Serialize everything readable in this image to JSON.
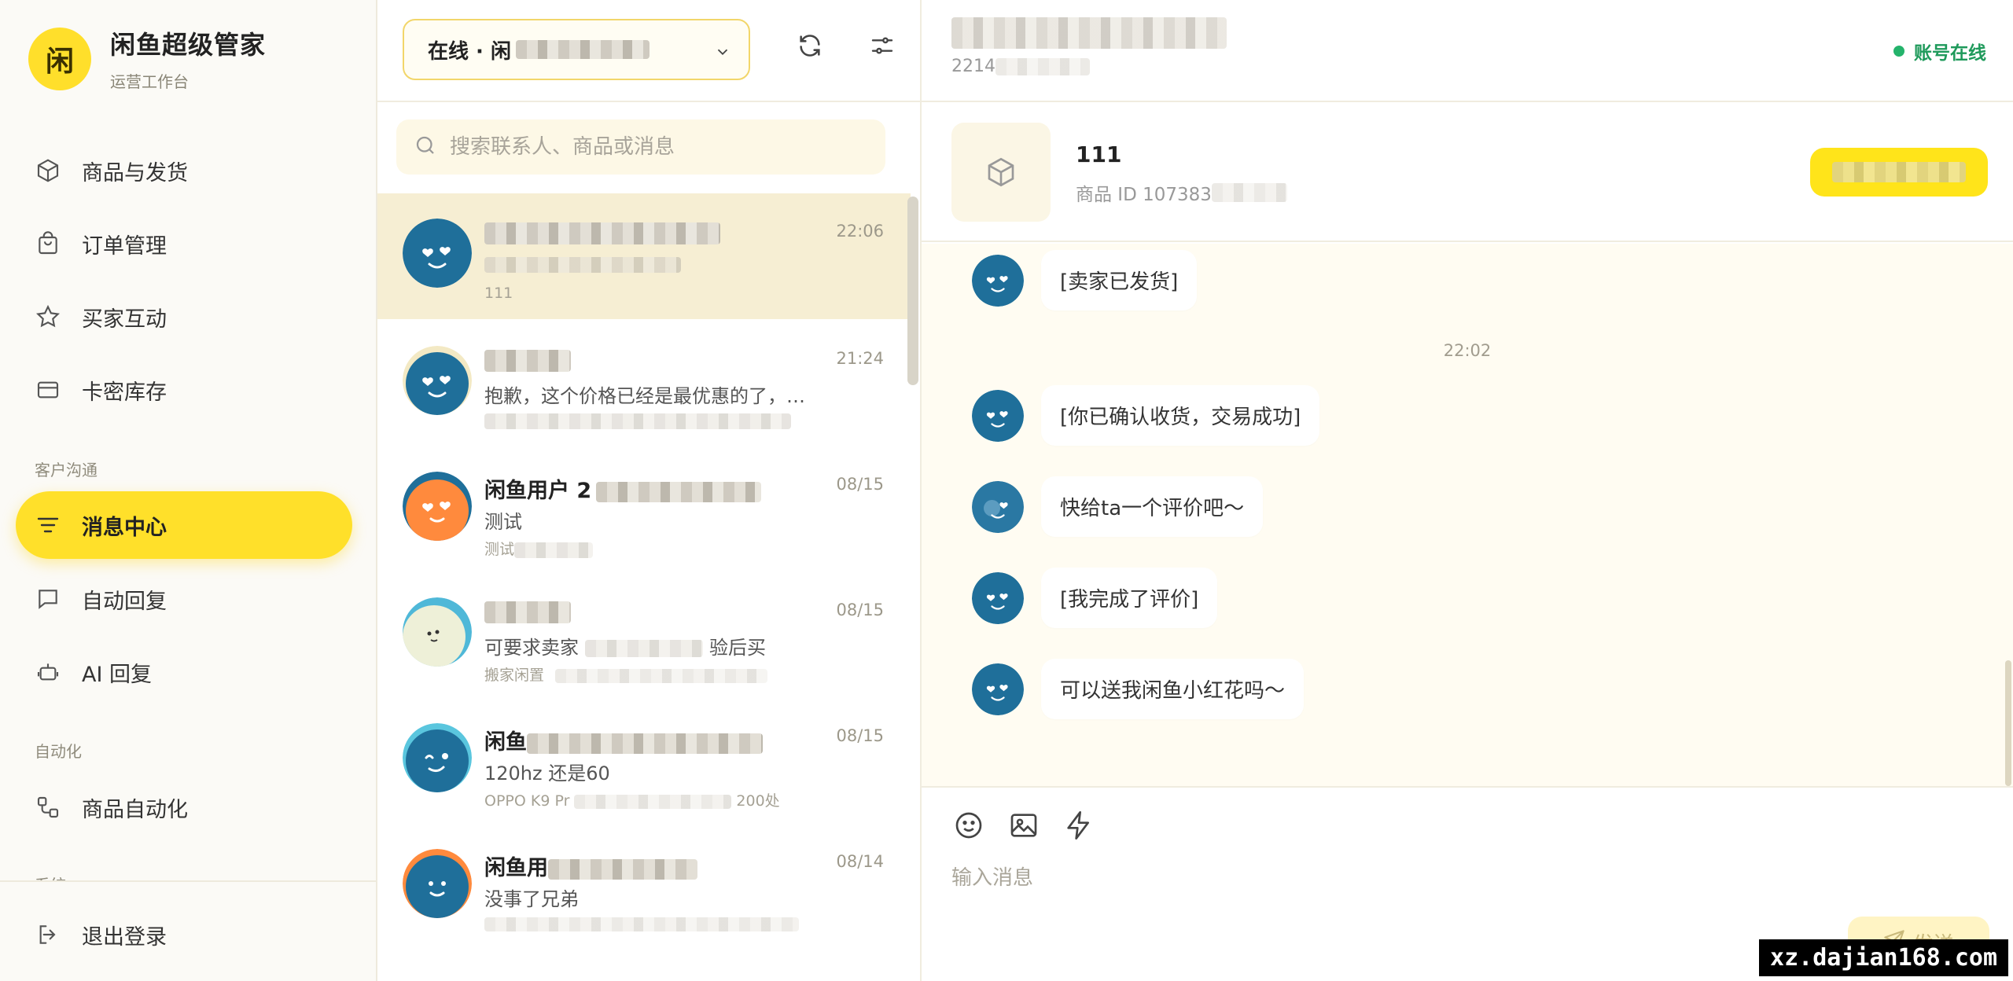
{
  "sidebar": {
    "brand": {
      "logo_char": "闲",
      "name": "闲鱼超级管家",
      "subtitle": "运营工作台"
    },
    "items": [
      {
        "label": "商品与发货",
        "icon": "box-icon"
      },
      {
        "label": "订单管理",
        "icon": "bag-icon"
      },
      {
        "label": "买家互动",
        "icon": "star-icon"
      },
      {
        "label": "卡密库存",
        "icon": "card-icon"
      }
    ],
    "section_comm": "客户沟通",
    "comm_items": [
      {
        "label": "消息中心",
        "icon": "filter-icon",
        "active": true
      },
      {
        "label": "自动回复",
        "icon": "chat-bubble-icon"
      },
      {
        "label": "AI 回复",
        "icon": "robot-icon"
      }
    ],
    "section_auto": "自动化",
    "auto_items": [
      {
        "label": "商品自动化",
        "icon": "flow-icon"
      }
    ],
    "section_system": "系统",
    "logout_label": "退出登录"
  },
  "convlist": {
    "account_select": "在线 · 闲",
    "search_placeholder": "搜索联系人、商品或消息",
    "conversations": [
      {
        "name": "",
        "time": "22:06",
        "preview": "",
        "sub": "111",
        "selected": true
      },
      {
        "name": "",
        "time": "21:24",
        "preview": "抱歉，这个价格已经是最优惠的了，不...",
        "sub": ""
      },
      {
        "name": "闲鱼用户 2",
        "time": "08/15",
        "preview": "测试",
        "sub": "测试"
      },
      {
        "name": "",
        "time": "08/15",
        "preview": "可要求卖家",
        "preview_tail": "验后买",
        "sub": "搬家闲置"
      },
      {
        "name": "闲鱼",
        "time": "08/15",
        "preview": "120hz 还是60",
        "sub": "OPPO K9 Pr",
        "sub_tail": "200处"
      },
      {
        "name": "闲鱼用",
        "time": "08/14",
        "preview": "没事了兄弟",
        "sub": ""
      }
    ]
  },
  "chat": {
    "header_id": "2214",
    "status": "账号在线",
    "product": {
      "title": "111",
      "id_label": "商品 ID 107383"
    },
    "messages": [
      {
        "text": "[卖家已发货]"
      },
      {
        "time": "22:02"
      },
      {
        "text": "[你已确认收货，交易成功]"
      },
      {
        "text": "快给ta一个评价吧～"
      },
      {
        "text": "[我完成了评价]"
      },
      {
        "text": "可以送我闲鱼小红花吗～"
      }
    ],
    "composer_placeholder": "输入消息",
    "send_label": "发送"
  },
  "watermark": "xz.dajian168.com",
  "colors": {
    "accent": "#ffe02a",
    "online": "#24b36b",
    "avatar_blue": "#1f6f9a",
    "avatar_orange": "#ff8a3d"
  }
}
